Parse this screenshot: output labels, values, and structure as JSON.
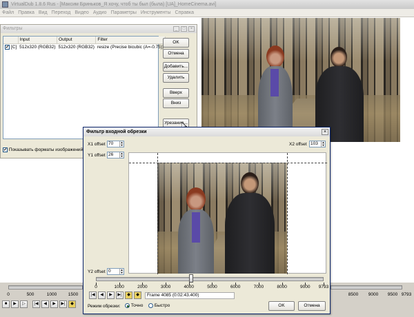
{
  "window": {
    "title": "VirtualDub 1.8.6 Rus - [Максим Бриньков_Я хочу, чтоб ты был (была) [UA]_HomeCinema.avi]"
  },
  "menu": [
    "Файл",
    "Правка",
    "Вид",
    "Переход",
    "Видео",
    "Аудио",
    "Параметры",
    "Инструменты",
    "Справка"
  ],
  "filters_dialog": {
    "title": "Фильтры",
    "columns": [
      "",
      "Input",
      "Output",
      "Filter"
    ],
    "rows": [
      {
        "checked": "✔",
        "flag": "[C]",
        "input": "512x320 (RGB32)",
        "output": "512x320 (RGB32)",
        "filter": "resize (Precise bicubic (A=-0.75))"
      }
    ],
    "buttons": {
      "ok": "OK",
      "cancel": "Отмена",
      "add": "Добавить...",
      "delete": "Удалить",
      "up": "Вверх",
      "down": "Вниз",
      "crop": "Урезание..."
    },
    "show_formats_checked": "✔",
    "show_formats_label": "Показывать форматы изображений"
  },
  "crop_dialog": {
    "title": "Фильтр входной обрезки",
    "x1_label": "X1 offset",
    "x1_value": "70",
    "y1_label": "Y1 offset",
    "y1_value": "26",
    "x2_label": "X2 offset",
    "x2_value": "103",
    "y2_label": "Y2 offset",
    "y2_value": "0",
    "ticks": [
      "0",
      "1000",
      "2000",
      "3000",
      "4000",
      "5000",
      "6000",
      "7000",
      "8000",
      "9000",
      "9793"
    ],
    "frame_info": "Frame 4085 (0:02:43.400)",
    "crop_mode_label": "Режим обрезки:",
    "mode_precise": "Точно",
    "mode_fast": "Быстро",
    "ok": "OK",
    "cancel": "Отмена",
    "position_fraction": 0.417
  },
  "main_timeline": {
    "ticks_left": [
      "0",
      "500",
      "1000",
      "1500"
    ],
    "ticks_right": [
      "8500",
      "9000",
      "9500",
      "9793"
    ]
  }
}
